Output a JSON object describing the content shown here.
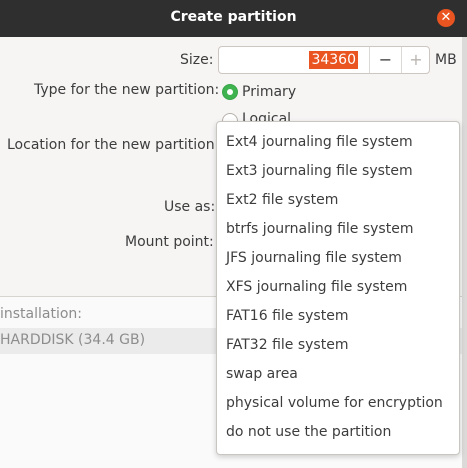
{
  "window": {
    "title": "Create partition"
  },
  "form": {
    "size_label": "Size:",
    "size_value": "34360",
    "size_minus": "−",
    "size_plus": "+",
    "size_unit": "MB",
    "type_label": "Type for the new partition:",
    "type_primary": "Primary",
    "type_logical": "Logical",
    "type_selected": "Primary",
    "location_label": "Location for the new partition:",
    "use_as_label": "Use as:",
    "mount_label": "Mount point:"
  },
  "background": {
    "installation_label": "installation:",
    "device_value": "HARDDISK (34.4 GB)"
  },
  "dropdown": {
    "items": [
      "Ext4 journaling file system",
      "Ext3 journaling file system",
      "Ext2 file system",
      "btrfs journaling file system",
      "JFS journaling file system",
      "XFS journaling file system",
      "FAT16 file system",
      "FAT32 file system",
      "swap area",
      "physical volume for encryption",
      "do not use the partition"
    ]
  },
  "colors": {
    "accent": "#e95420",
    "radio_selected": "#3eb34f",
    "titlebar": "#2f2f2f"
  },
  "icons": {
    "close": "close-icon"
  }
}
